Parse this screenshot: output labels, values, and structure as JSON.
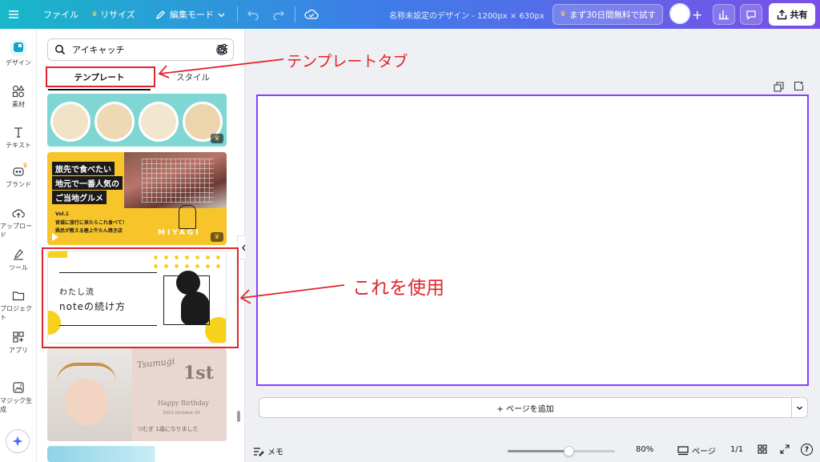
{
  "topbar": {
    "file_label": "ファイル",
    "resize_label": "リサイズ",
    "edit_mode_label": "編集モード",
    "doc_title": "名称未設定のデザイン - 1200px × 630px",
    "trial_label": "まず30日間無料で試す",
    "share_label": "共有"
  },
  "rail": {
    "design": "デザイン",
    "elements": "素材",
    "text": "テキスト",
    "brand": "ブランド",
    "uploads": "アップロード",
    "tools": "ツール",
    "projects": "プロジェクト",
    "apps": "アプリ",
    "magic": "マジック生成"
  },
  "panel": {
    "search_value": "アイキャッチ",
    "tab_templates": "テンプレート",
    "tab_styles": "スタイル"
  },
  "templates": {
    "t2_line1": "旅先で食べたい",
    "t2_line2": "地元で一番人気の",
    "t2_line3": "ご当地グルメ",
    "t2_vol": "Vol.1",
    "t2_sub1": "宮城に旅行に来たらこれ食べて！",
    "t2_sub2": "県民が教える極上牛たん焼き店",
    "t2_brand": "MIYAGI",
    "t3_line1": "わたし流",
    "t3_line2": "noteの続け方",
    "t4_name": "Tsumugi",
    "t4_big": "1st",
    "t4_bday": "Happy Birthday",
    "t4_date": "2022 October 20",
    "t4_caption": "つむぎ 1歳になりました"
  },
  "canvas": {
    "add_page_label": "+ ページを追加"
  },
  "bottombar": {
    "notes_label": "メモ",
    "zoom_percent": "80%",
    "zoom_level": 0.57,
    "pages_label": "ページ",
    "page_counter": "1/1",
    "help_label": "?"
  },
  "annotations": {
    "template_tab_note": "テンプレートタブ",
    "use_this_note": "これを使用"
  },
  "colors": {
    "accent_purple": "#8b3dff",
    "annotation_red": "#e0242b"
  }
}
